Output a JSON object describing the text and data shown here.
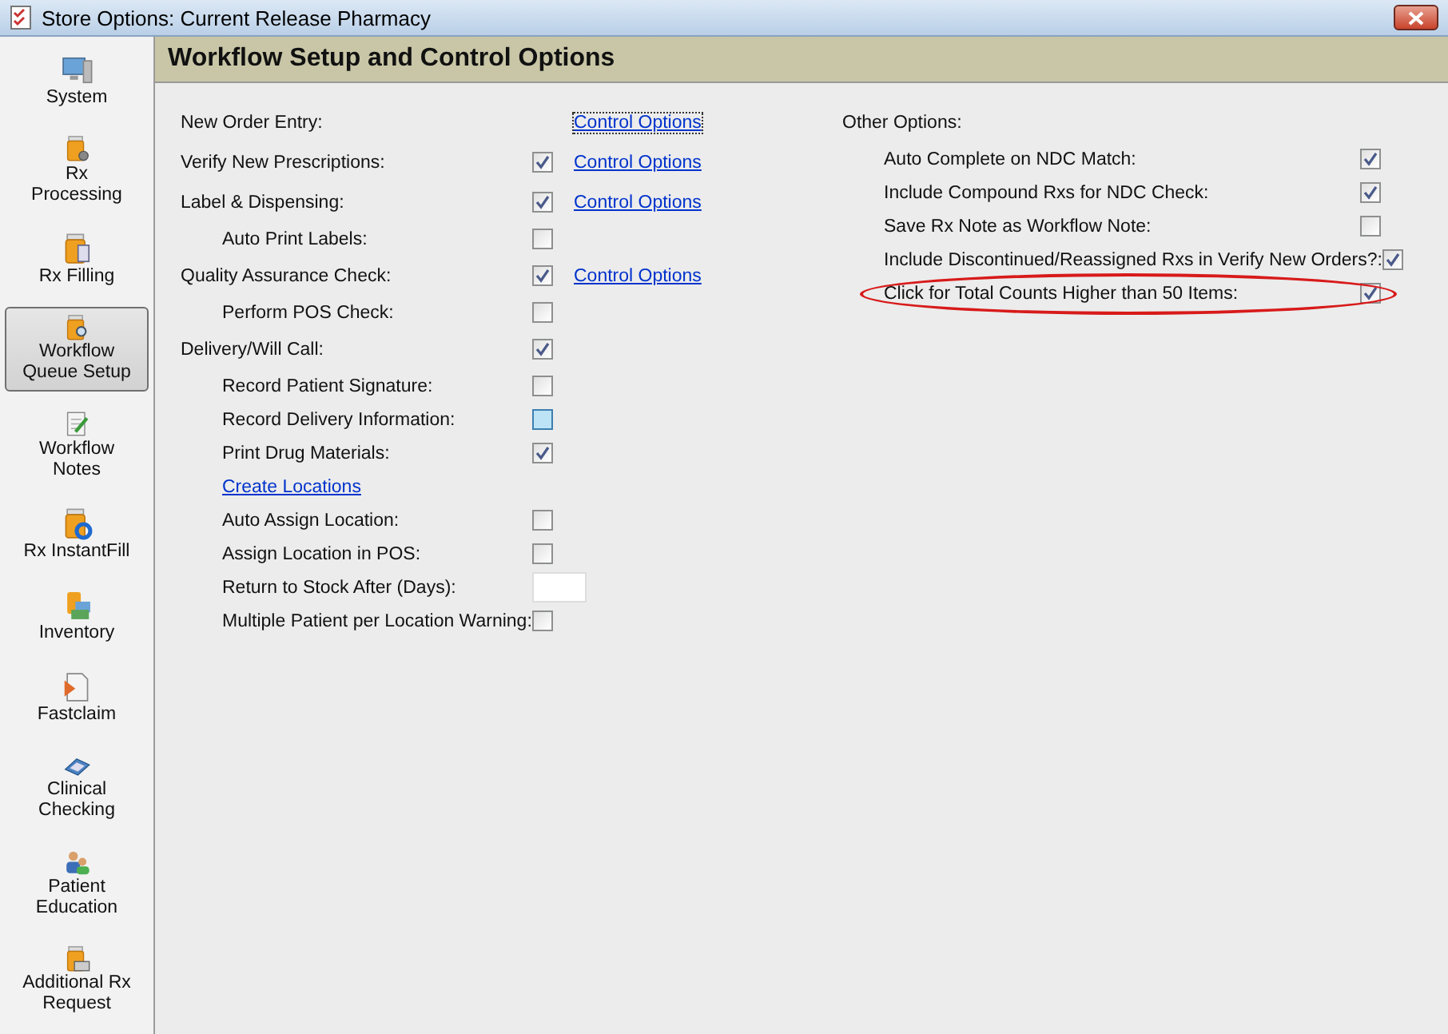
{
  "window": {
    "title": "Store Options: Current Release Pharmacy"
  },
  "sidebar": {
    "items": [
      {
        "label": "System",
        "selected": false
      },
      {
        "label": "Rx Processing",
        "selected": false
      },
      {
        "label": "Rx Filling",
        "selected": false
      },
      {
        "label": "Workflow Queue Setup",
        "selected": true
      },
      {
        "label": "Workflow Notes",
        "selected": false
      },
      {
        "label": "Rx InstantFill",
        "selected": false
      },
      {
        "label": "Inventory",
        "selected": false
      },
      {
        "label": "Fastclaim",
        "selected": false
      },
      {
        "label": "Clinical Checking",
        "selected": false
      },
      {
        "label": "Patient Education",
        "selected": false
      },
      {
        "label": "Additional Rx Request",
        "selected": false
      }
    ]
  },
  "header": {
    "title": "Workflow Setup and Control Options"
  },
  "left_options": [
    {
      "kind": "option",
      "label": "New Order Entry:",
      "link": "Control Options",
      "link_focused": true
    },
    {
      "kind": "checkbox",
      "label": "Verify New Prescriptions:",
      "checked": true,
      "link": "Control Options",
      "link_focused": false
    },
    {
      "kind": "checkbox",
      "label": "Label & Dispensing:",
      "checked": true,
      "link": "Control Options",
      "link_focused": false,
      "children": [
        {
          "kind": "checkbox",
          "label": "Auto Print Labels:",
          "checked": false
        }
      ]
    },
    {
      "kind": "checkbox",
      "label": "Quality Assurance Check:",
      "checked": true,
      "link": "Control Options",
      "link_focused": false,
      "children": [
        {
          "kind": "checkbox",
          "label": "Perform POS Check:",
          "checked": false
        }
      ]
    },
    {
      "kind": "checkbox",
      "label": "Delivery/Will Call:",
      "checked": true,
      "children": [
        {
          "kind": "checkbox",
          "label": "Record Patient Signature:",
          "checked": false
        },
        {
          "kind": "checkbox",
          "label": "Record Delivery Information:",
          "checked": false,
          "hovered": true
        },
        {
          "kind": "checkbox",
          "label": "Print Drug Materials:",
          "checked": true
        },
        {
          "kind": "link",
          "label": "Create Locations"
        },
        {
          "kind": "checkbox",
          "label": "Auto Assign Location:",
          "checked": false
        },
        {
          "kind": "checkbox",
          "label": "Assign Location in POS:",
          "checked": false
        },
        {
          "kind": "field",
          "label": "Return to Stock After (Days):"
        },
        {
          "kind": "checkbox",
          "label": "Multiple Patient per Location Warning:",
          "checked": false
        }
      ]
    }
  ],
  "other_options": {
    "title": "Other Options:",
    "items": [
      {
        "label": "Auto Complete on NDC Match:",
        "checked": true,
        "circled": false
      },
      {
        "label": "Include Compound Rxs for NDC Check:",
        "checked": true,
        "circled": false
      },
      {
        "label": "Save Rx Note as Workflow Note:",
        "checked": false,
        "circled": false
      },
      {
        "label": "Include Discontinued/Reassigned Rxs in Verify New Orders?:",
        "checked": true,
        "circled": false
      },
      {
        "label": "Click for Total Counts Higher than 50 Items:",
        "checked": true,
        "circled": true
      }
    ]
  }
}
